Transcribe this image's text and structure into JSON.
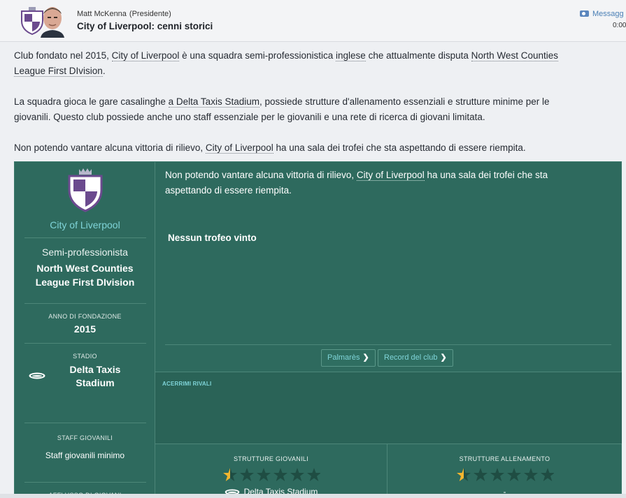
{
  "header": {
    "sender_name": "Matt McKenna",
    "sender_role": "(Presidente)",
    "subject": "City of Liverpool: cenni storici",
    "messages_link": "Messagg",
    "time": "0:00"
  },
  "intro": {
    "p1": {
      "t1": "Club fondato nel 2015, ",
      "club_link": "City of Liverpool",
      "t2": " è una squadra semi-professionistica ",
      "nation_link": "inglese",
      "t3": " che attualmente disputa ",
      "league_link_1": "North West Counties",
      "league_link_2": "League First DIvision",
      "t4": "."
    },
    "p2": {
      "t1": "La squadra gioca le gare casalinghe ",
      "stadium_link": "a Delta Taxis Stadium",
      "t2": ", possiede strutture d'allenamento essenziali e strutture minime per le",
      "t3": "giovanili. Questo club possiede anche uno staff essenziale per le giovanili e una rete di ricerca di giovani limitata."
    },
    "p3": {
      "t1": "Non potendo vantare alcuna vittoria di rilievo, ",
      "club_link": "City of Liverpool",
      "t2": " ha una sala dei trofei che sta aspettando di essere riempita."
    }
  },
  "panel": {
    "club_name": "City of Liverpool",
    "status": "Semi-professionista",
    "league_line1": "North West Counties",
    "league_line2": "League First DIvision",
    "founded_label": "ANNO DI FONDAZIONE",
    "founded_year": "2015",
    "stadium_label": "STADIO",
    "stadium_line1": "Delta Taxis",
    "stadium_line2": "Stadium",
    "staff_label": "STAFF GIOVANILI",
    "staff_value": "Staff giovanili minimo",
    "youth_intake_label": "AFFLUSSO DI GIOVANI",
    "trophy_text_1": "Non potendo vantare alcuna vittoria di rilievo, ",
    "trophy_club_link": "City of Liverpool",
    "trophy_text_2": " ha una sala dei trofei che sta",
    "trophy_text_3": "aspettando di essere riempita.",
    "no_trophies": "Nessun trofeo vinto",
    "palmares_button": "Palmarès",
    "records_button": "Record del club",
    "rivals_label": "ACERRIMI RIVALI",
    "youth_facilities_label": "STRUTTURE GIOVANILI",
    "youth_facilities_stars": 0.5,
    "youth_facilities_sub": "Delta Taxis Stadium",
    "training_facilities_label": "STRUTTURE ALLENAMENTO",
    "training_facilities_stars": 0.5,
    "training_facilities_sub": "-"
  },
  "colors": {
    "panel_green": "#2e6a5e",
    "accent_cyan": "#7fd4d8",
    "star_gold": "#f2b630",
    "crest_purple": "#6b4a8e"
  },
  "icons": [
    "club-crest-icon",
    "manager-avatar",
    "mail-icon",
    "stadium-icon",
    "star-icon",
    "chevron-right-icon"
  ]
}
